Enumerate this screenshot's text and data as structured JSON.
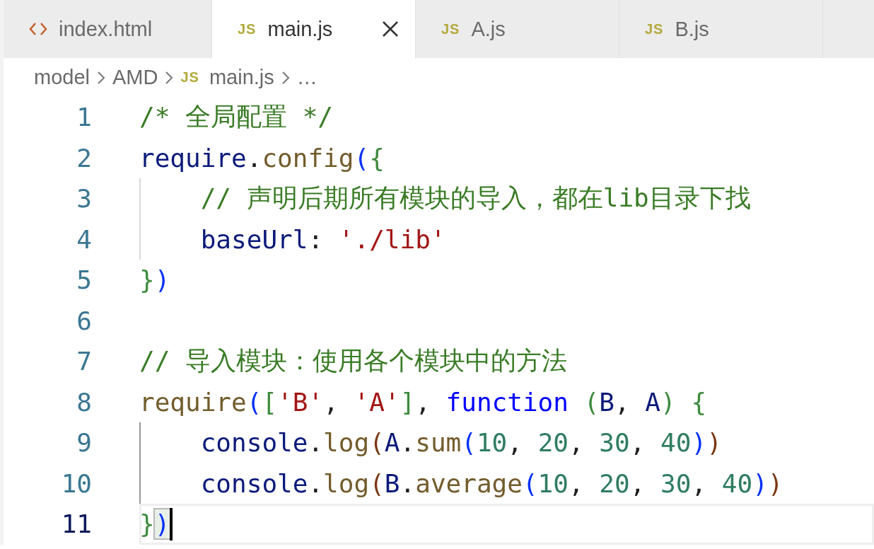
{
  "tabs": [
    {
      "kind": "html",
      "label": "index.html",
      "selected": false
    },
    {
      "kind": "js",
      "icon_text": "JS",
      "label": "main.js",
      "selected": true
    },
    {
      "kind": "js",
      "icon_text": "JS",
      "label": "A.js",
      "selected": false
    },
    {
      "kind": "js",
      "icon_text": "JS",
      "label": "B.js",
      "selected": false
    }
  ],
  "breadcrumb": [
    {
      "label": "model"
    },
    {
      "label": "AMD"
    },
    {
      "label": "main.js",
      "icon_text": "JS"
    },
    {
      "label": "…"
    }
  ],
  "lines": [
    {
      "number": "1",
      "tokens": [
        {
          "kind": "comment",
          "text": "/* 全局配置 */"
        }
      ]
    },
    {
      "number": "2",
      "tokens": [
        {
          "kind": "var",
          "text": "require"
        },
        {
          "kind": "plain",
          "text": "."
        },
        {
          "kind": "func",
          "text": "config"
        },
        {
          "kind": "b1",
          "text": "("
        },
        {
          "kind": "b2",
          "text": "{"
        }
      ]
    },
    {
      "number": "3",
      "guide": true,
      "tokens": [
        {
          "kind": "comment",
          "text": "    // 声明后期所有模块的导入，都在lib目录下找"
        }
      ]
    },
    {
      "number": "4",
      "guide": true,
      "tokens": [
        {
          "kind": "var",
          "text": "    baseUrl"
        },
        {
          "kind": "plain",
          "text": ": "
        },
        {
          "kind": "string",
          "text": "'./lib'"
        }
      ]
    },
    {
      "number": "5",
      "tokens": [
        {
          "kind": "b2",
          "text": "}"
        },
        {
          "kind": "b1",
          "text": ")"
        }
      ]
    },
    {
      "number": "6"
    },
    {
      "number": "7",
      "tokens": [
        {
          "kind": "comment",
          "text": "// 导入模块：使用各个模块中的方法"
        }
      ]
    },
    {
      "number": "8",
      "tokens": [
        {
          "kind": "func",
          "text": "require"
        },
        {
          "kind": "b1",
          "text": "("
        },
        {
          "kind": "b2",
          "text": "["
        },
        {
          "kind": "string",
          "text": "'B'"
        },
        {
          "kind": "plain",
          "text": ", "
        },
        {
          "kind": "string",
          "text": "'A'"
        },
        {
          "kind": "b2",
          "text": "]"
        },
        {
          "kind": "plain",
          "text": ", "
        },
        {
          "kind": "keyword",
          "text": "function"
        },
        {
          "kind": "b2",
          "text": " ("
        },
        {
          "kind": "var",
          "text": "B"
        },
        {
          "kind": "plain",
          "text": ", "
        },
        {
          "kind": "var",
          "text": "A"
        },
        {
          "kind": "b2",
          "text": ") {"
        }
      ]
    },
    {
      "number": "9",
      "guide": true,
      "guide_active": true,
      "tokens": [
        {
          "kind": "var",
          "text": "    console"
        },
        {
          "kind": "plain",
          "text": "."
        },
        {
          "kind": "func",
          "text": "log"
        },
        {
          "kind": "b3",
          "text": "("
        },
        {
          "kind": "var",
          "text": "A"
        },
        {
          "kind": "plain",
          "text": "."
        },
        {
          "kind": "func",
          "text": "sum"
        },
        {
          "kind": "b1",
          "text": "("
        },
        {
          "kind": "number",
          "text": "10"
        },
        {
          "kind": "plain",
          "text": ", "
        },
        {
          "kind": "number",
          "text": "20"
        },
        {
          "kind": "plain",
          "text": ", "
        },
        {
          "kind": "number",
          "text": "30"
        },
        {
          "kind": "plain",
          "text": ", "
        },
        {
          "kind": "number",
          "text": "40"
        },
        {
          "kind": "b1",
          "text": ")"
        },
        {
          "kind": "b3",
          "text": ")"
        }
      ]
    },
    {
      "number": "10",
      "guide": true,
      "guide_active": true,
      "tokens": [
        {
          "kind": "var",
          "text": "    console"
        },
        {
          "kind": "plain",
          "text": "."
        },
        {
          "kind": "func",
          "text": "log"
        },
        {
          "kind": "b3",
          "text": "("
        },
        {
          "kind": "var",
          "text": "B"
        },
        {
          "kind": "plain",
          "text": "."
        },
        {
          "kind": "func",
          "text": "average"
        },
        {
          "kind": "b1",
          "text": "("
        },
        {
          "kind": "number",
          "text": "10"
        },
        {
          "kind": "plain",
          "text": ", "
        },
        {
          "kind": "number",
          "text": "20"
        },
        {
          "kind": "plain",
          "text": ", "
        },
        {
          "kind": "number",
          "text": "30"
        },
        {
          "kind": "plain",
          "text": ", "
        },
        {
          "kind": "number",
          "text": "40"
        },
        {
          "kind": "b1",
          "text": ")"
        },
        {
          "kind": "b3",
          "text": ")"
        }
      ]
    },
    {
      "number": "11",
      "current": true,
      "cursor": true,
      "tokens": [
        {
          "kind": "b2",
          "text": "}"
        },
        {
          "kind": "b1",
          "text": ")",
          "matched": true
        }
      ]
    }
  ]
}
